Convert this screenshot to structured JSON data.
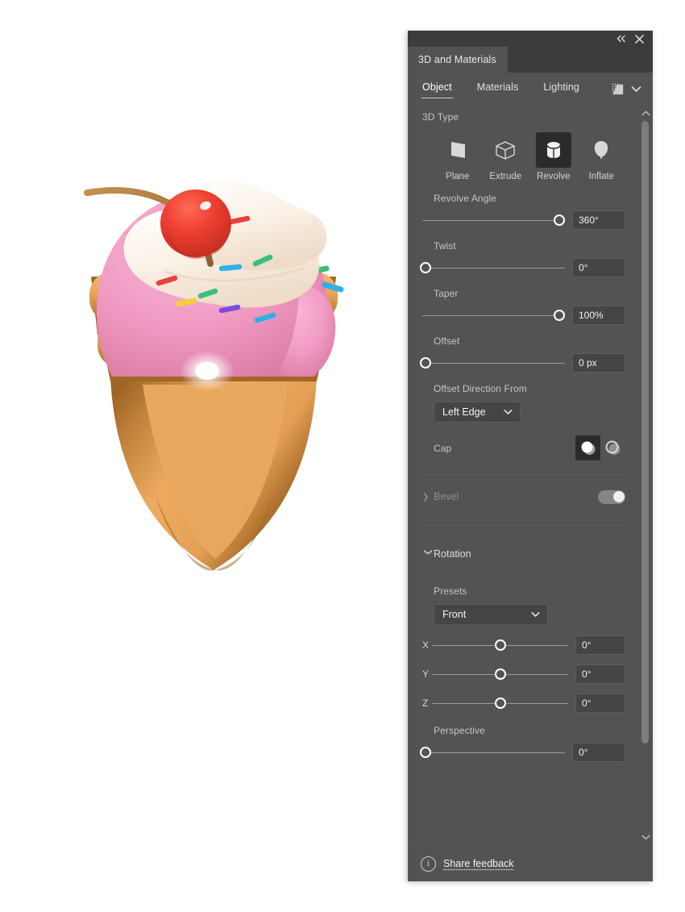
{
  "window": {
    "title": "3D and Materials",
    "collapse_icon": "collapse-double-chevron-icon",
    "close_icon": "close-icon"
  },
  "subtabs": [
    {
      "label": "Object",
      "active": true
    },
    {
      "label": "Materials",
      "active": false
    },
    {
      "label": "Lighting",
      "active": false
    }
  ],
  "subtabs_right": {
    "render_icon": "render-preview-icon",
    "chevron_icon": "chevron-down-icon"
  },
  "object": {
    "type_section_label": "3D Type",
    "types": [
      {
        "label": "Plane",
        "icon": "plane-icon",
        "selected": false
      },
      {
        "label": "Extrude",
        "icon": "extrude-icon",
        "selected": false
      },
      {
        "label": "Revolve",
        "icon": "revolve-icon",
        "selected": true
      },
      {
        "label": "Inflate",
        "icon": "inflate-icon",
        "selected": false
      }
    ],
    "revolve_angle": {
      "label": "Revolve Angle",
      "value": "360°",
      "knob_pct": 96
    },
    "twist": {
      "label": "Twist",
      "value": "0°",
      "knob_pct": 2
    },
    "taper": {
      "label": "Taper",
      "value": "100%",
      "knob_pct": 96
    },
    "offset": {
      "label": "Offset",
      "value": "0 px",
      "knob_pct": 2
    },
    "offset_direction": {
      "label": "Offset Direction From",
      "value": "Left Edge"
    },
    "cap": {
      "label": "Cap",
      "options": [
        {
          "icon": "cap-solid-icon",
          "selected": true
        },
        {
          "icon": "cap-hollow-icon",
          "selected": false
        }
      ]
    },
    "bevel": {
      "label": "Bevel",
      "enabled": false,
      "expanded": false,
      "toggle_on": false
    }
  },
  "rotation": {
    "title": "Rotation",
    "expanded": true,
    "presets_label": "Presets",
    "preset_value": "Front",
    "axes": [
      {
        "axis": "X",
        "value": "0°",
        "knob_pct": 50
      },
      {
        "axis": "Y",
        "value": "0°",
        "knob_pct": 50
      },
      {
        "axis": "Z",
        "value": "0°",
        "knob_pct": 50
      }
    ],
    "perspective": {
      "label": "Perspective",
      "value": "0°",
      "knob_pct": 2
    }
  },
  "scrollbar": {
    "up_arrow_icon": "chevron-up-icon",
    "down_arrow_icon": "chevron-down-icon"
  },
  "footer": {
    "info_icon": "info-icon",
    "feedback_label": "Share feedback"
  },
  "artwork": {
    "name": "3d-ice-cream-cone",
    "colors": {
      "cherry": "#ef4237",
      "cherry_dark": "#cf3226",
      "stem": "#a9773c",
      "cream": "#fdf3ea",
      "cream_shadow": "#f0dccd",
      "scoop_pink": "#f09ac3",
      "scoop_pink_dark": "#dd7fae",
      "cone": "#eda95e",
      "cone_dark": "#a86c2c",
      "cone_mid": "#cf8c42"
    },
    "sprinkle_colors": [
      "#e8413c",
      "#3fa9f5",
      "#39c07c",
      "#f5d232",
      "#7a4ddb",
      "#2fb0e8"
    ]
  }
}
